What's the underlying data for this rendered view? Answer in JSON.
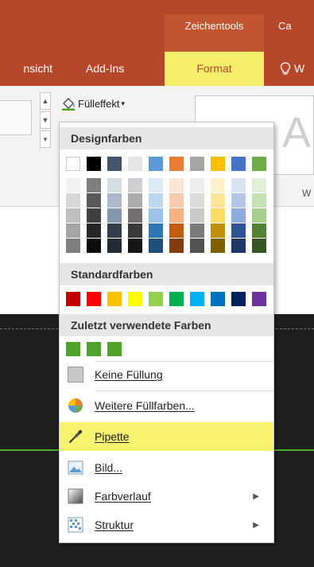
{
  "ribbon": {
    "context_label": "Zeichentools",
    "context_next": "Ca",
    "tabs": [
      {
        "label": "nsicht"
      },
      {
        "label": "Add-Ins"
      },
      {
        "label": "Format"
      },
      {
        "label": "W"
      }
    ],
    "fill_button_label": "Fülleffekt",
    "wordart_letter": "A",
    "group_letter": "W"
  },
  "menu": {
    "theme_header": "Designfarben",
    "standard_header": "Standardfarben",
    "recent_header": "Zuletzt verwendete Farben",
    "theme_top_row": [
      "#ffffff",
      "#000000",
      "#44546a",
      "#e7e6e6",
      "#5b9bd5",
      "#ed7d31",
      "#a5a5a5",
      "#ffc000",
      "#4472c4",
      "#70ad47"
    ],
    "theme_shades": [
      [
        "#f2f2f2",
        "#7f7f7f",
        "#d6dce4",
        "#d0cece",
        "#deebf6",
        "#fbe5d5",
        "#ededed",
        "#fff2cc",
        "#dae3f3",
        "#e2efd9"
      ],
      [
        "#d8d8d8",
        "#595959",
        "#adb9ca",
        "#aeabab",
        "#bdd7ee",
        "#f7cbac",
        "#dbdbdb",
        "#fee599",
        "#b4c6e7",
        "#c5e0b3"
      ],
      [
        "#bfbfbf",
        "#3f3f3f",
        "#8496b0",
        "#757070",
        "#9dc3e6",
        "#f4b183",
        "#c9c9c9",
        "#ffd966",
        "#8faadc",
        "#a8d08d"
      ],
      [
        "#a5a5a5",
        "#262626",
        "#333f4f",
        "#3a3838",
        "#2e75b5",
        "#c55a11",
        "#7b7b7b",
        "#bf9000",
        "#2f5496",
        "#538135"
      ],
      [
        "#7f7f7f",
        "#0c0c0c",
        "#222a35",
        "#171616",
        "#1e4e79",
        "#833c0b",
        "#525252",
        "#7f6000",
        "#1f3864",
        "#375623"
      ]
    ],
    "standard_colors": [
      "#c00000",
      "#ff0000",
      "#ffc000",
      "#ffff00",
      "#92d050",
      "#00b050",
      "#00b0f0",
      "#0070c0",
      "#002060",
      "#7030a0"
    ],
    "recent_colors": [
      "#4fa32b",
      "#4fa32b",
      "#4fa32b"
    ],
    "items": [
      {
        "label": "Keine Füllung",
        "icon": "no-fill-icon"
      },
      {
        "label": "Weitere Füllfarben...",
        "icon": "color-wheel-icon"
      },
      {
        "label": "Pipette",
        "icon": "eyedropper-icon",
        "highlighted": true
      },
      {
        "label": "Bild...",
        "icon": "picture-icon"
      },
      {
        "label": "Farbverlauf",
        "icon": "gradient-icon",
        "submenu": true
      },
      {
        "label": "Struktur",
        "icon": "texture-icon",
        "submenu": true
      }
    ]
  },
  "colors": {
    "accent": "#b7472a",
    "highlight": "#f7f36e",
    "slide_line": "#4cae2b"
  }
}
